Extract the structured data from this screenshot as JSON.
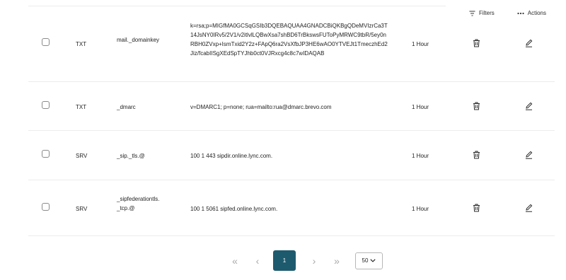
{
  "toolbar": {
    "filters_label": "Filters",
    "actions_label": "Actions"
  },
  "records": [
    {
      "type": "TXT",
      "name": "mail._domainkey",
      "value": "k=rsa;p=MIGfMA0GCSqGSIb3DQEBAQUAA4GNADCBiQKBgQDeMVIzrCa3T14JsNY0IRv5/2V1/v2itlvlLQBwXsa7shBD6TrBkswsFUToPyMRWC9tbR/5ey0nRBH0ZVxp+IsmTxid2Y2z+FApQ6ra2VsXfbJP3HE6wAO0YTVEJt1TmeczhEd2Jiz/fcabIISgXEdSpTYJhb0ct0VJRxcg4c8c7wIDAQAB",
      "ttl": "1 Hour"
    },
    {
      "type": "TXT",
      "name": "_dmarc",
      "value": "v=DMARC1; p=none; rua=mailto:rua@dmarc.brevo.com",
      "ttl": "1 Hour"
    },
    {
      "type": "SRV",
      "name": "_sip._tls.@",
      "value": "100 1 443 sipdir.online.lync.com.",
      "ttl": "1 Hour"
    },
    {
      "type": "SRV",
      "name": "_sipfederationtls._tcp.@",
      "value": "100 1 5061 sipfed.online.lync.com.",
      "ttl": "1 Hour"
    }
  ],
  "pagination": {
    "first_glyph": "«",
    "prev_glyph": "‹",
    "current_page": "1",
    "next_glyph": "›",
    "last_glyph": "»",
    "page_size": "50"
  },
  "icons": {
    "filters": "filter-icon",
    "actions": "more-dots-icon",
    "delete": "trash-icon",
    "edit": "pencil-icon",
    "page_size": "chevron-down-icon"
  },
  "colors": {
    "accent": "#1e5a6e",
    "divider": "#ececec",
    "muted_arrow": "#a9a9a9"
  }
}
